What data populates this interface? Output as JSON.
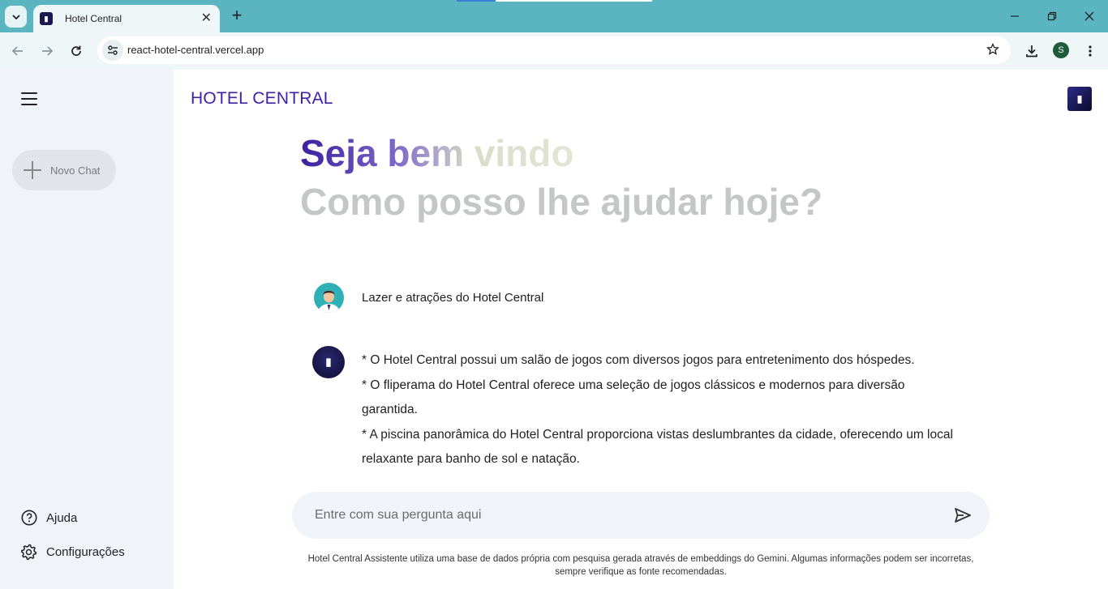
{
  "browser": {
    "tab_title": "Hotel Central",
    "url": "react-hotel-central.vercel.app",
    "profile_initial": "S",
    "theme_color": "#5bb5c0"
  },
  "sidebar": {
    "new_chat_label": "Novo Chat",
    "help_label": "Ajuda",
    "settings_label": "Configurações"
  },
  "header": {
    "brand": "HOTEL CENTRAL",
    "brand_color": "#3e23a6"
  },
  "greeting": {
    "title": "Seja bem vindo!",
    "subtitle": "Como posso lhe ajudar hoje?"
  },
  "conversation": {
    "user_message": "Lazer e atrações do Hotel Central",
    "bot_lines": [
      "* O Hotel Central possui um salão de jogos com diversos jogos para entretenimento dos hóspedes.",
      "* O fliperama do Hotel Central oferece uma seleção de jogos clássicos e modernos para diversão garantida.",
      "* A piscina panorâmica do Hotel Central proporciona vistas deslumbrantes da cidade, oferecendo um local relaxante para banho de sol e natação."
    ]
  },
  "prompt": {
    "placeholder": "Entre com sua pergunta aqui",
    "value": ""
  },
  "disclaimer": "Hotel Central Assistente utiliza uma base de dados própria com pesquisa gerada através de embeddings do Gemini. Algumas informações podem ser incorretas, sempre verifique as fonte recomendadas."
}
